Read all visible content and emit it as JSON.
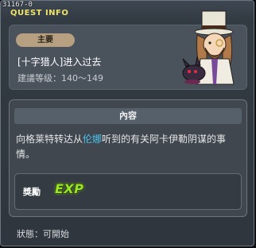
{
  "window": {
    "id": "31167-0",
    "title": "QUEST INFO"
  },
  "quest": {
    "type_badge": "主要",
    "name": "[十字猎人]进入过去",
    "level": "建議等级：140～149",
    "npc_icon": "npc-portrait-icon"
  },
  "content": {
    "header": "內容",
    "description_before": "向格莱特转达从",
    "description_highlight": "伦娜",
    "description_after": "听到的有关阿卡伊勒阴谋的事情。",
    "highlight_color": "#4ec3f0"
  },
  "reward": {
    "label": "獎勵",
    "exp_label": "EXP",
    "exp_color": "#9be42a"
  },
  "status": {
    "text": "狀態：可開始"
  }
}
